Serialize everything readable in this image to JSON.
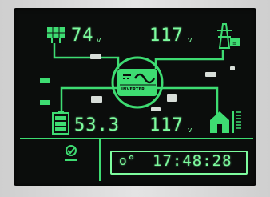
{
  "pv_voltage": "74",
  "pv_voltage_unit": "v",
  "grid_voltage": "117",
  "grid_voltage_unit": "v",
  "battery_voltage": "53.3",
  "output_voltage": "117",
  "output_voltage_unit": "v",
  "inverter_label": "INVERTER",
  "time_prefix": "o°",
  "clock": "17:48:28",
  "colors": {
    "lcd": "#0b0d0c",
    "segment": "#7dfc9e",
    "bar": "#3edc72"
  },
  "icons": [
    "solar-panel-icon",
    "grid-tower-icon",
    "battery-icon",
    "house-load-icon",
    "inverter-icon",
    "check-icon",
    "settings-icon"
  ]
}
